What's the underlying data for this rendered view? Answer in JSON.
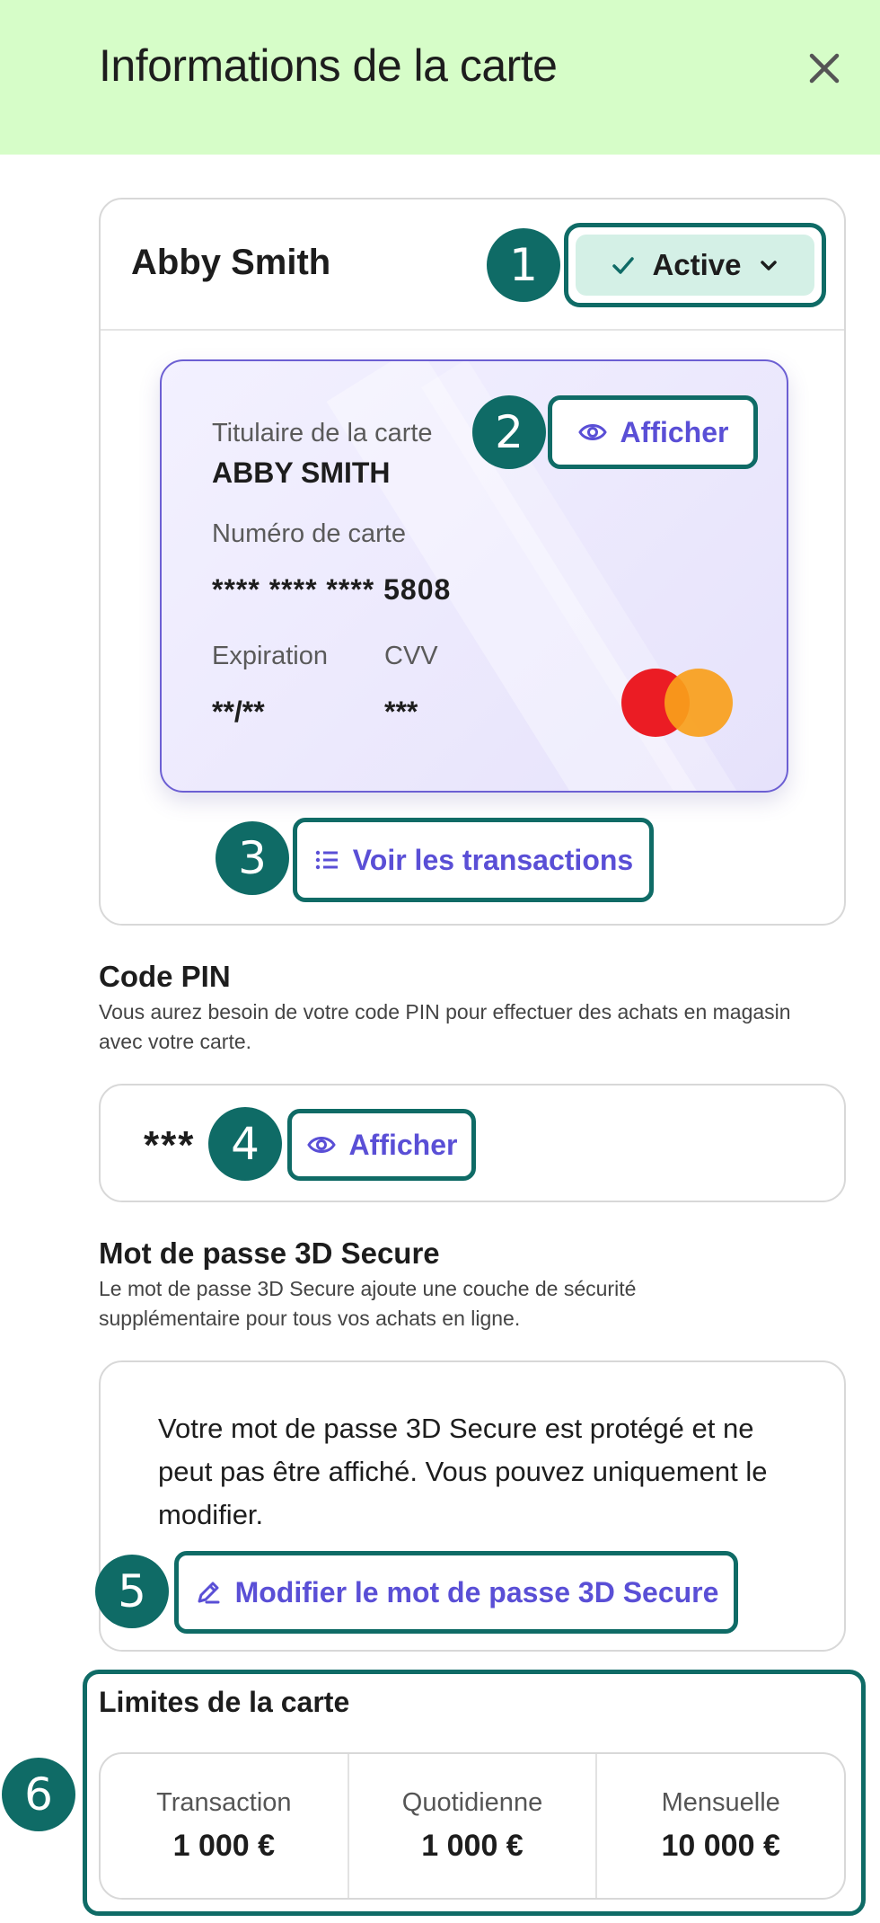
{
  "header": {
    "title": "Informations de la carte",
    "close_icon": "close-icon",
    "background": "#d6fdc8"
  },
  "card": {
    "holder_name": "Abby Smith",
    "status_label": "Active",
    "holder_label": "Titulaire de la carte",
    "holder_value": "ABBY SMITH",
    "number_label": "Numéro de carte",
    "number_value": "**** **** **** 5808",
    "expiry_label": "Expiration",
    "expiry_value": "**/**",
    "cvv_label": "CVV",
    "cvv_value": "***",
    "show_label": "Afficher",
    "transactions_label": "Voir les transactions",
    "network_icon": "mastercard-logo"
  },
  "pin": {
    "title": "Code PIN",
    "description": "Vous aurez besoin de votre code PIN pour effectuer des achats en magasin avec votre carte.",
    "value": "***",
    "show_label": "Afficher"
  },
  "secure3d": {
    "title": "Mot de passe 3D Secure",
    "description": "Le mot de passe 3D Secure ajoute une couche de sécurité supplémentaire pour tous vos achats en ligne.",
    "info": "Votre mot de passe 3D Secure est protégé et ne peut pas être affiché. Vous pouvez uniquement le modifier.",
    "edit_label": "Modifier le mot de passe 3D Secure"
  },
  "limits": {
    "title": "Limites de la carte",
    "items": [
      {
        "label": "Transaction",
        "value": "1 000 €"
      },
      {
        "label": "Quotidienne",
        "value": "1 000 €"
      },
      {
        "label": "Mensuelle",
        "value": "10 000 €"
      }
    ]
  },
  "annotations": [
    "1",
    "2",
    "3",
    "4",
    "5",
    "6"
  ],
  "colors": {
    "accent": "#5a4fd6",
    "annotation": "#0f6b66",
    "status_bg": "#d4f0e6"
  }
}
